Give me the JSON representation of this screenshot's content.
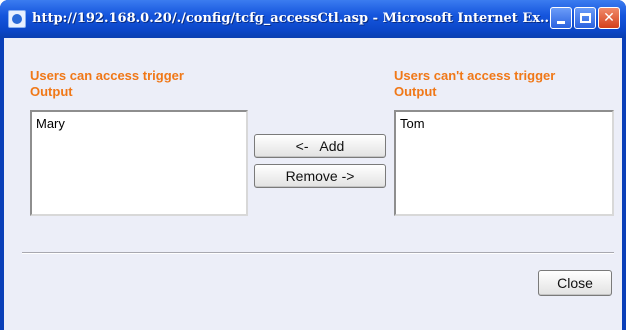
{
  "window": {
    "title": "http://192.168.0.20/./config/tcfg_accessCtl.asp - Microsoft Internet Ex...",
    "controls": {
      "minimize": "",
      "maximize": "",
      "close": "✕"
    }
  },
  "left_panel": {
    "label_line1": "Users can access trigger",
    "label_line2": "Output",
    "items": [
      "Mary"
    ]
  },
  "right_panel": {
    "label_line1": "Users can't access trigger",
    "label_line2": "Output",
    "items": [
      "Tom"
    ]
  },
  "buttons": {
    "add": "<-   Add",
    "remove": "Remove ->",
    "close": "Close"
  },
  "colors": {
    "label": "#f07818",
    "titlebar": "#1555dd",
    "client_bg": "#eceef8"
  }
}
